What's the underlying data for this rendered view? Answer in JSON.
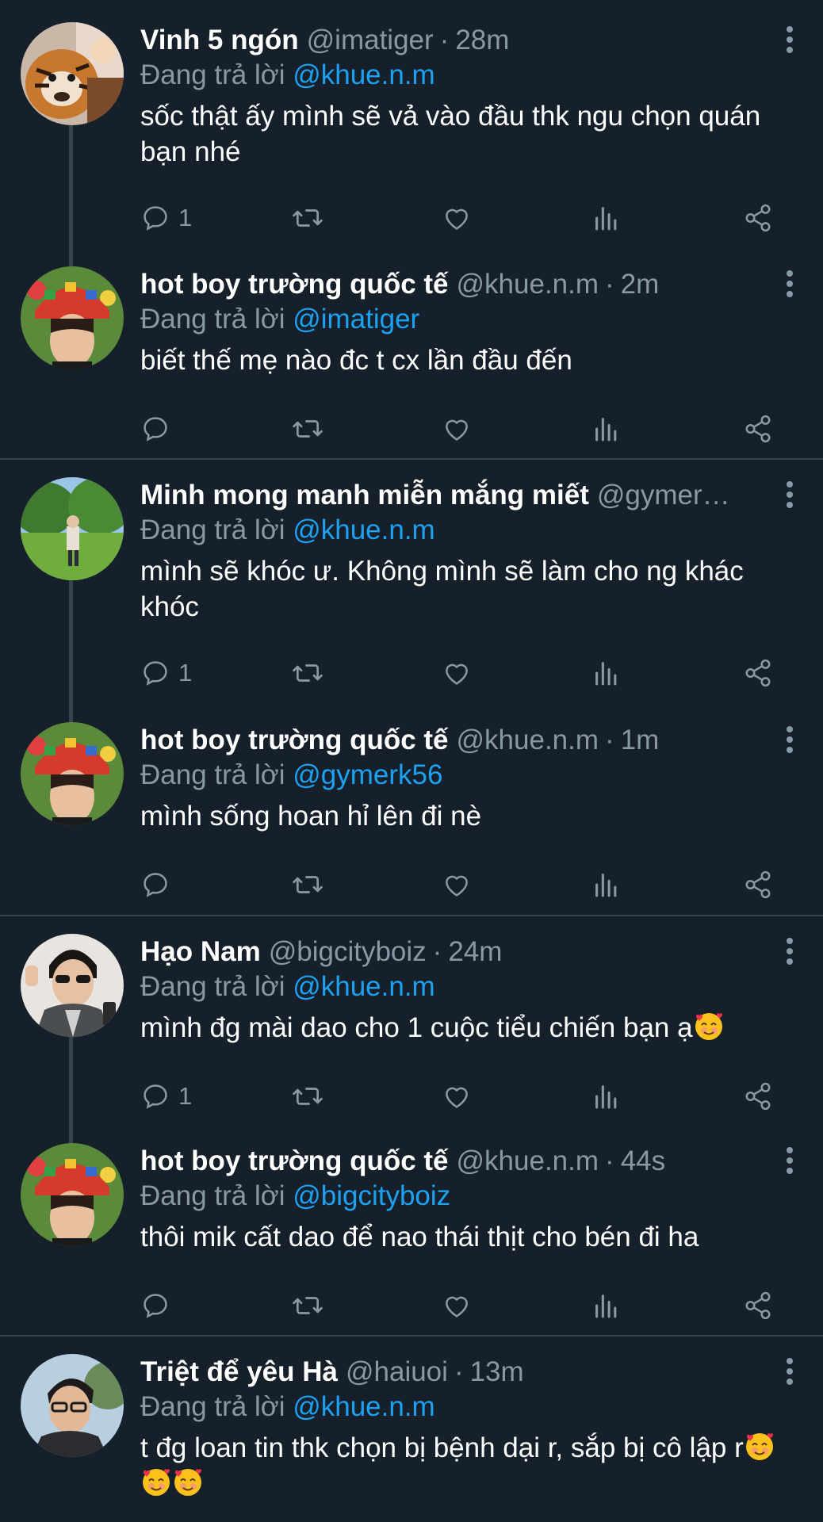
{
  "reply_prefix": "Đang trả lời",
  "tweets": [
    {
      "name": "Vinh 5 ngón",
      "handle": "@imatiger",
      "sep": "·",
      "time": "28m",
      "mention": "@khue.n.m",
      "text": "sốc thật ấy mình sẽ vả vào đầu thk ngu chọn quán bạn nhé",
      "reply_count": "1",
      "avatar_icon": "tiger-photo"
    },
    {
      "name": "hot boy trường quốc tế",
      "handle": "@khue.n.m",
      "sep": "·",
      "time": "2m",
      "mention": "@imatiger",
      "text": "biết thế mẹ nào đc t cx lần đầu đến",
      "reply_count": "",
      "avatar_icon": "person-photo"
    },
    {
      "name": "Minh mong manh miễn mắng miết",
      "handle": "@gymer…",
      "sep": "",
      "time": "",
      "mention": "@khue.n.m",
      "text": "mình sẽ khóc ư. Không mình sẽ làm cho ng khác khóc",
      "reply_count": "1",
      "avatar_icon": "park-photo"
    },
    {
      "name": "hot boy trường quốc tế",
      "handle": "@khue.n.m",
      "sep": "·",
      "time": "1m",
      "mention": "@gymerk56",
      "text": "mình sống hoan hỉ lên đi nè",
      "reply_count": "",
      "avatar_icon": "person-photo"
    },
    {
      "name": "Hạo Nam",
      "handle": "@bigcityboiz",
      "sep": "·",
      "time": "24m",
      "mention": "@khue.n.m",
      "text": "mình đg mài dao cho 1 cuộc tiểu chiến bạn ạ",
      "reply_count": "1",
      "avatar_icon": "person-photo"
    },
    {
      "name": "hot boy trường quốc tế",
      "handle": "@khue.n.m",
      "sep": "·",
      "time": "44s",
      "mention": "@bigcityboiz",
      "text": "thôi mik cất dao để nao thái thịt cho bén đi ha",
      "reply_count": "",
      "avatar_icon": "person-photo"
    },
    {
      "name": "Triệt để yêu Hà",
      "handle": "@haiuoi",
      "sep": "·",
      "time": "13m",
      "mention": "@khue.n.m",
      "text": "t đg loan tin thk chọn bị bệnh dại r, sắp bị cô lập r",
      "reply_count": "",
      "avatar_icon": "person-photo"
    }
  ],
  "action_icons": [
    "reply-icon",
    "retweet-icon",
    "like-icon",
    "analytics-icon",
    "share-icon"
  ],
  "emoji_icon": "smiling-face-with-hearts-emoji",
  "colors": {
    "background": "#15202b",
    "text": "#ffffff",
    "muted": "#8899a6",
    "link": "#1da1f2",
    "divider": "#38444d"
  }
}
